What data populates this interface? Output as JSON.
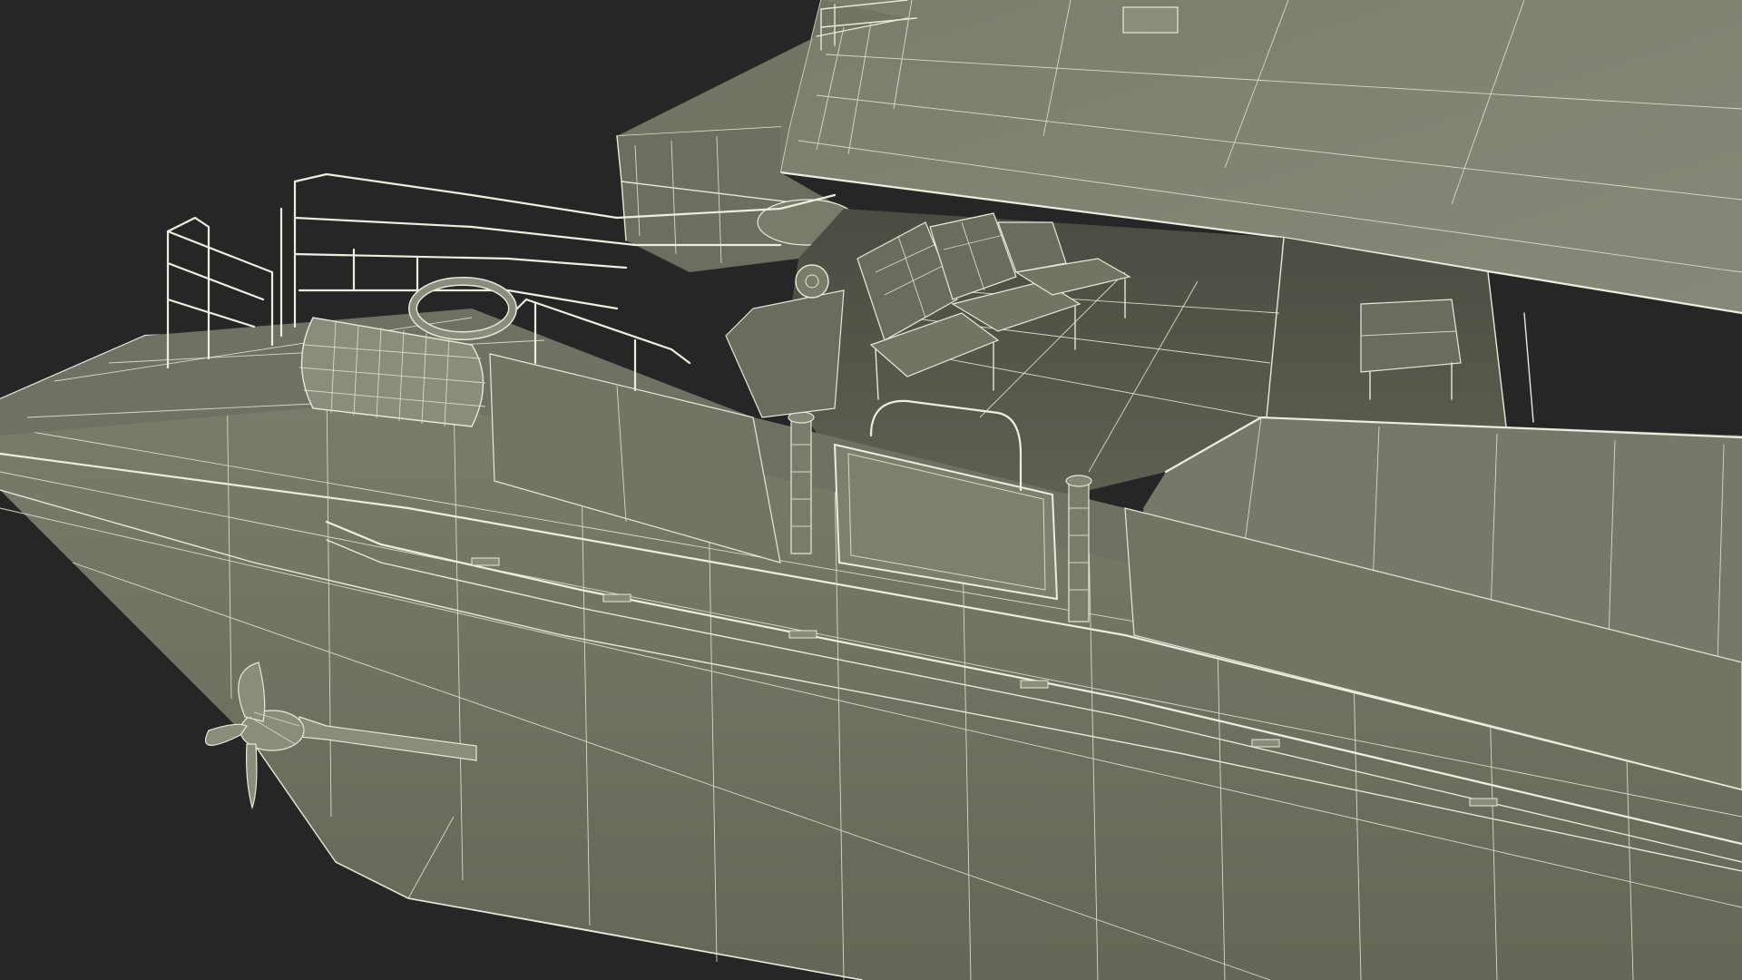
{
  "scene": {
    "colors": {
      "background": "#262626",
      "hull_fill": "#787a69",
      "hull_dark": "#5e6053",
      "deck_fill": "#6d6f60",
      "roof_fill": "#808271",
      "interior_fill": "#55574c",
      "wire": "#e9e9da"
    }
  }
}
